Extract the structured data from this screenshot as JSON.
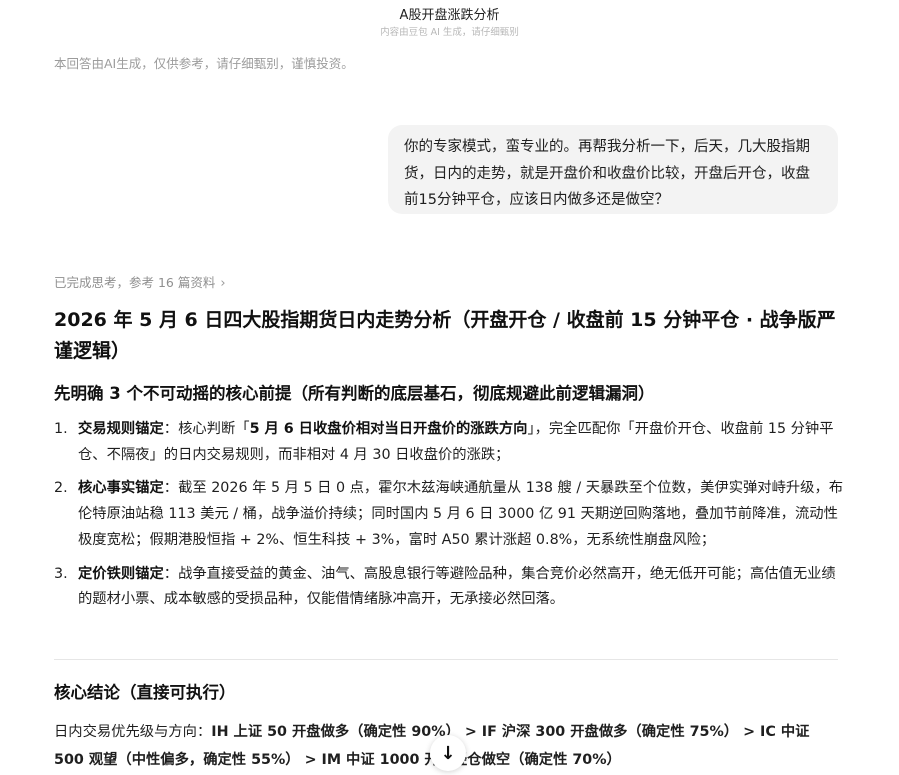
{
  "header": {
    "title": "A股开盘涨跌分析",
    "subtitle": "内容由豆包 AI 生成，请仔细甄别"
  },
  "disclaimer": "本回答由AI生成，仅供参考，请仔细甄别，谨慎投资。",
  "user_message": "你的专家模式，蛮专业的。再帮我分析一下，后天，几大股指期货，日内的走势，就是开盘价和收盘价比较，开盘后开仓，收盘前15分钟平仓，应该日内做多还是做空？",
  "thinking": {
    "label": "已完成思考，参考 16 篇资料",
    "icon": "chevron-right-icon"
  },
  "answer": {
    "title": "2026 年 5 月 6 日四大股指期货日内走势分析（开盘开仓 / 收盘前 15 分钟平仓 · 战争版严谨逻辑）",
    "section1_heading": "先明确 3 个不可动摇的核心前提（所有判断的底层基石，彻底规避此前逻辑漏洞）",
    "premises": [
      {
        "num": "1.",
        "label": "交易规则锚定",
        "before": "：核心判断「",
        "bold": "5 月 6 日收盘价相对当日开盘价的涨跌方向",
        "after": "」，完全匹配你「开盘价开仓、收盘前 15 分钟平仓、不隔夜」的日内交易规则，而非相对 4 月 30 日收盘价的涨跌；"
      },
      {
        "num": "2.",
        "label": "核心事实锚定",
        "text": "：截至 2026 年 5 月 5 日 0 点，霍尔木兹海峡通航量从 138 艘 / 天暴跌至个位数，美伊实弹对峙升级，布伦特原油站稳 113 美元 / 桶，战争溢价持续；同时国内 5 月 6 日 3000 亿 91 天期逆回购落地，叠加节前降准，流动性极度宽松；假期港股恒指 + 2%、恒生科技 + 3%，富时 A50 累计涨超 0.8%，无系统性崩盘风险；"
      },
      {
        "num": "3.",
        "label": "定价铁则锚定",
        "text": "：战争直接受益的黄金、油气、高股息银行等避险品种，集合竞价必然高开，绝无低开可能；高估值无业绩的题材小票、成本敏感的受损品种，仅能借情绪脉冲高开，无承接必然回落。"
      }
    ],
    "conclusion_heading": "核心结论（直接可执行）",
    "conclusion_prefix": "日内交易优先级与方向：",
    "conclusion_bold_1": "IH 上证 50 开盘做多（确定性 90%）",
    "sep_1": " > ",
    "conclusion_bold_2": "IF 沪深 300 开盘做多（确定性 75%）",
    "sep_2": " > ",
    "conclusion_bold_3": "IC 中证 500 观望（中性偏多，确定性 55%）",
    "sep_3": " > ",
    "conclusion_bold_4": "IM 中证 1000 开盘轻仓做空（确定性 70%）"
  },
  "scroll_button": {
    "icon": "arrow-down-icon",
    "glyph": "↓"
  }
}
